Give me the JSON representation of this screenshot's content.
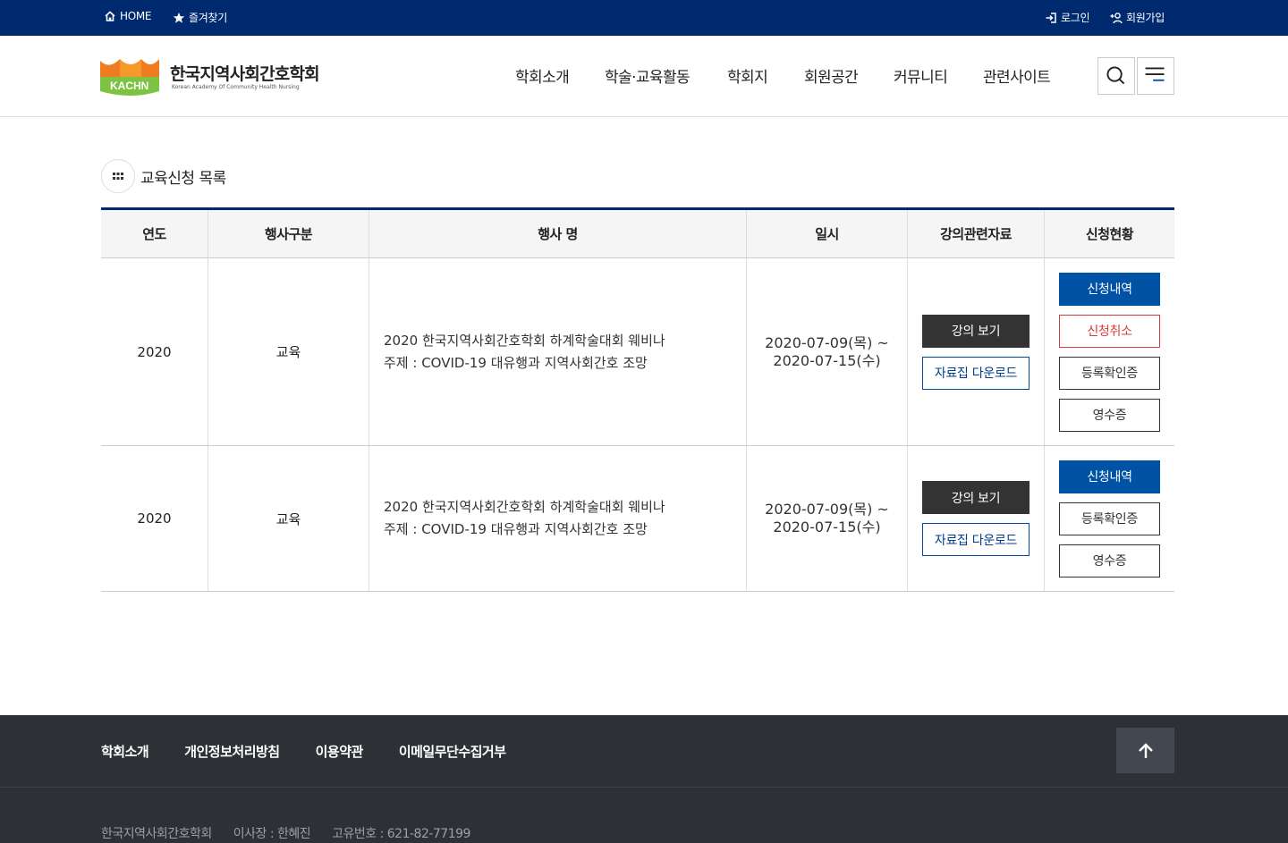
{
  "topbar": {
    "home": "HOME",
    "favorite": "즐겨찾기",
    "login": "로그인",
    "join": "회원가입"
  },
  "logo": {
    "mark_text": "KACHN",
    "name": "한국지역사회간호학회",
    "sub": "Korean Academy Of Community Health Nursing"
  },
  "nav": [
    "학회소개",
    "학술·교육활동",
    "학회지",
    "회원공간",
    "커뮤니티",
    "관련사이트"
  ],
  "section": {
    "title": "교육신청 목록"
  },
  "table": {
    "headers": [
      "연도",
      "행사구분",
      "행사 명",
      "일시",
      "강의관련자료",
      "신청현황"
    ],
    "rows": [
      {
        "year": "2020",
        "category": "교육",
        "event_line1": "2020 한국지역사회간호학회 하계학술대회 웨비나",
        "event_line2": "주제 : COVID-19 대유행과 지역사회간호 조망",
        "date_start": "2020-07-09(목) ~",
        "date_end": "2020-07-15(수)",
        "lecture_button": "강의 보기",
        "download_button": "자료집 다운로드",
        "status_buttons": [
          "신청내역",
          "신청취소",
          "등록확인증",
          "영수증"
        ]
      },
      {
        "year": "2020",
        "category": "교육",
        "event_line1": "2020 한국지역사회간호학회 하계학술대회 웨비나",
        "event_line2": "주제 : COVID-19 대유행과 지역사회간호 조망",
        "date_start": "2020-07-09(목) ~",
        "date_end": "2020-07-15(수)",
        "lecture_button": "강의 보기",
        "download_button": "자료집 다운로드",
        "status_buttons": [
          "신청내역",
          "등록확인증",
          "영수증"
        ]
      }
    ]
  },
  "footer": {
    "links": [
      "학회소개",
      "개인정보처리방침",
      "이용약관",
      "이메일무단수집거부"
    ],
    "org": "한국지역사회간호학회",
    "president": "이사장 : 한혜진",
    "reg_no": "고유번호 : 621-82-77199"
  },
  "colors": {
    "topbar": "#002a70",
    "primary_button": "#0052a4",
    "cancel": "#d83a3a",
    "footer": "#2d3035"
  }
}
